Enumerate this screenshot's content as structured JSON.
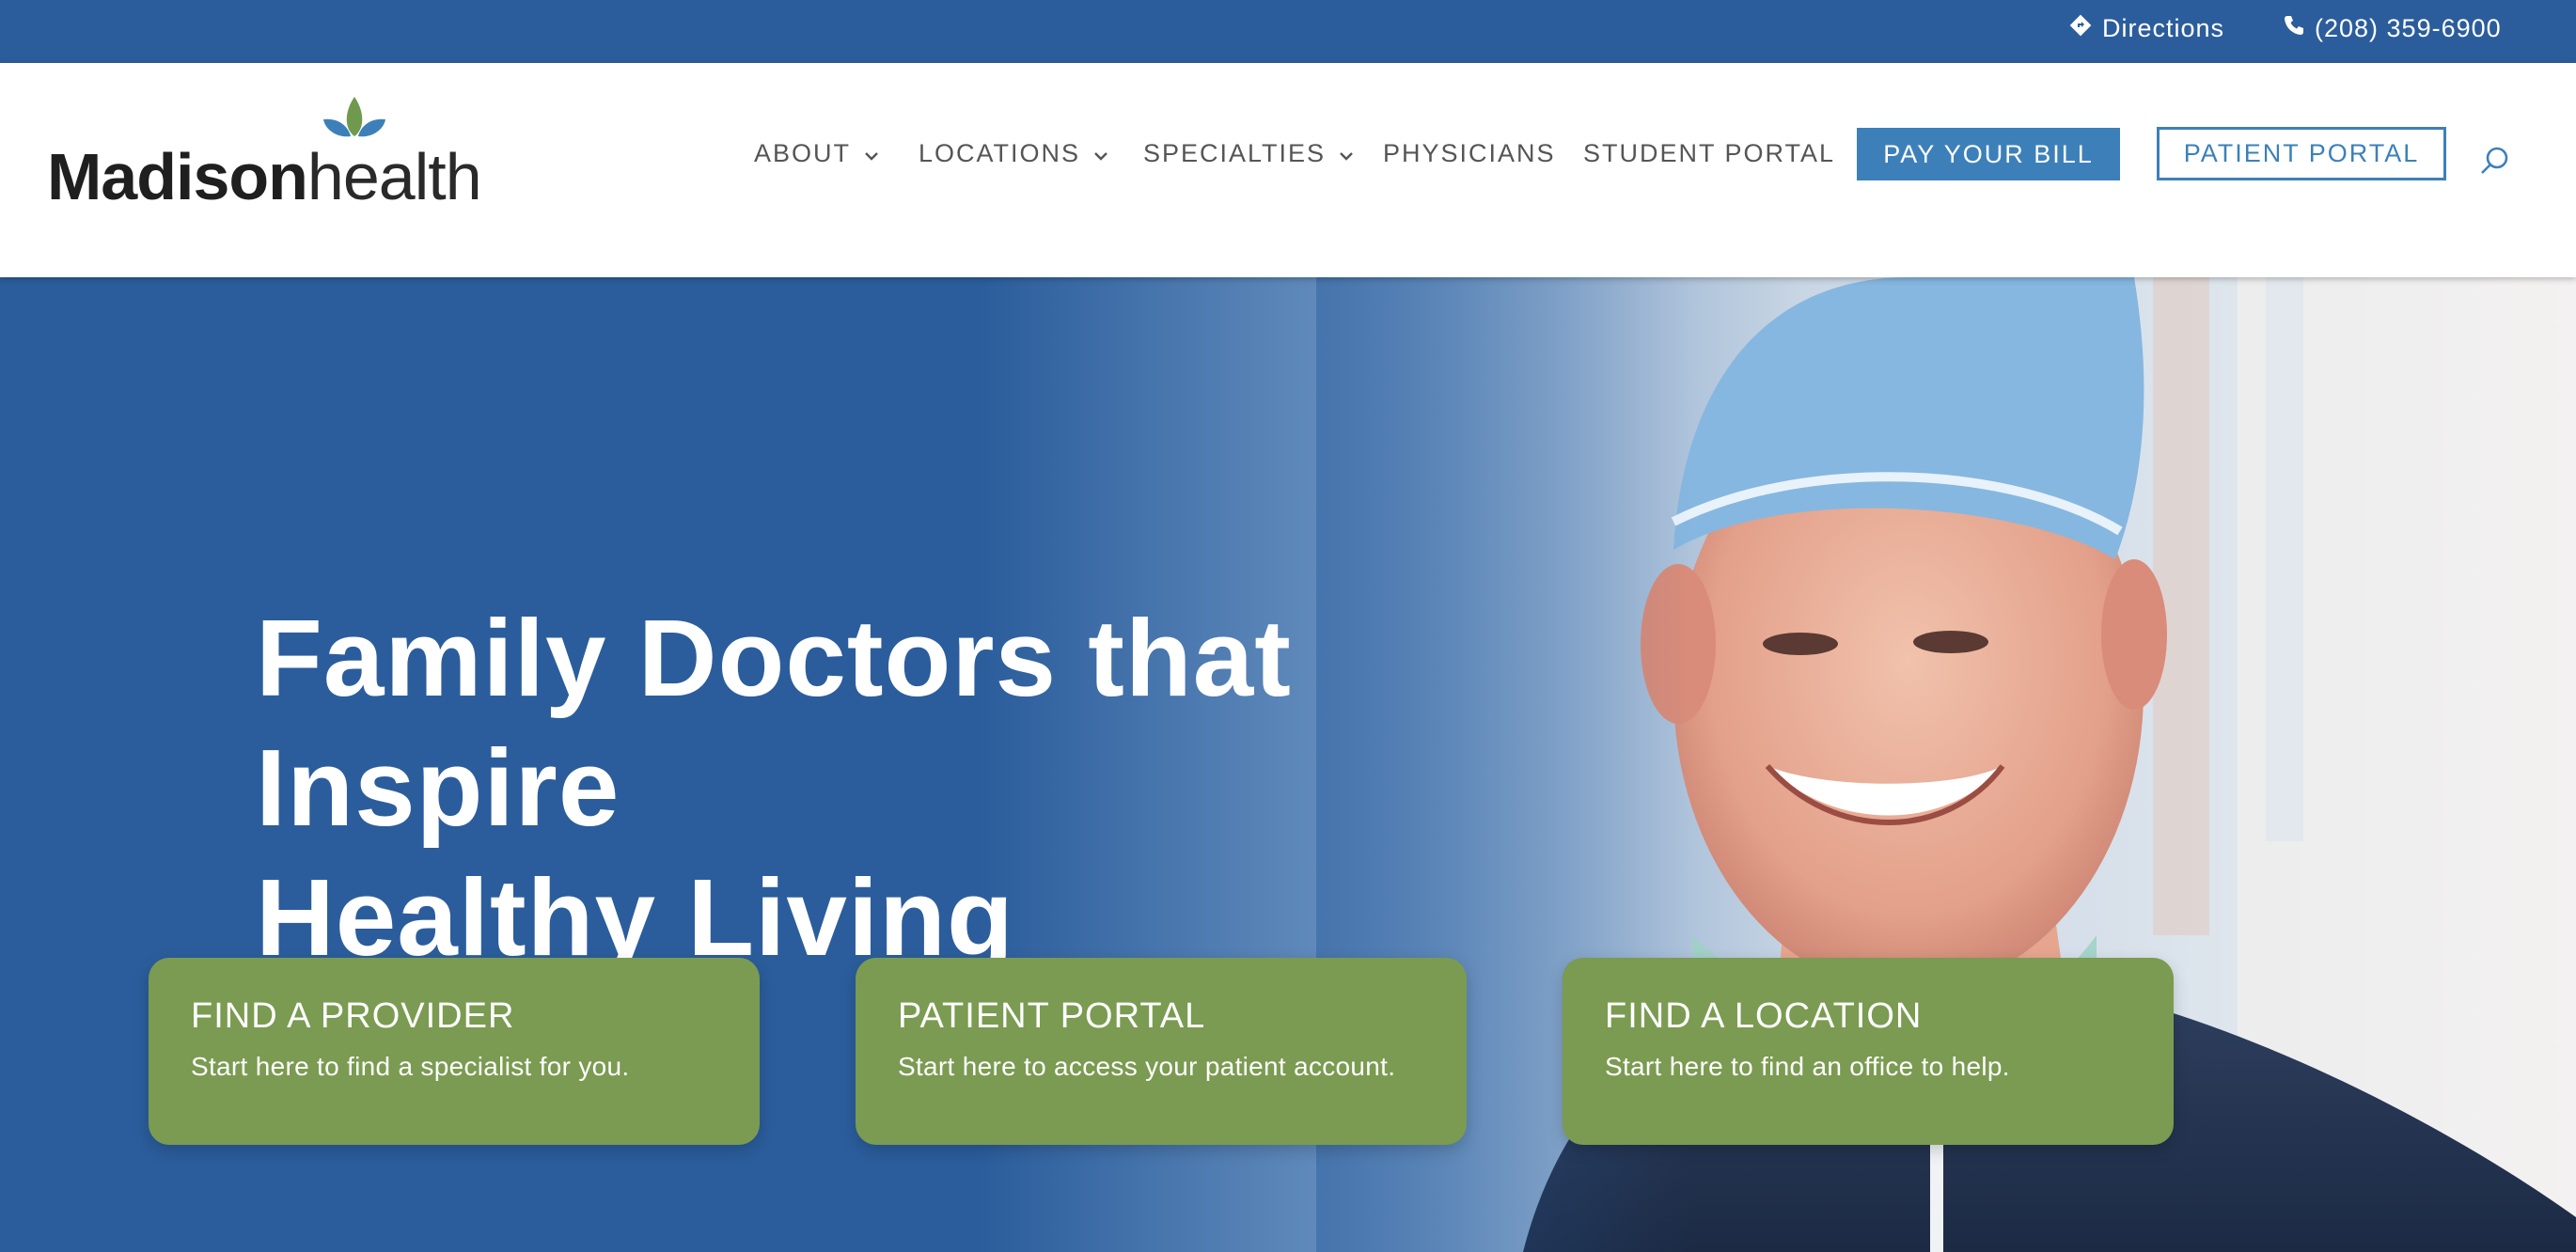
{
  "colors": {
    "brand_blue": "#2b5d9c",
    "button_blue": "#3d80b9",
    "card_green": "#7a9b51",
    "logo_leaf_green": "#6f9a4e",
    "logo_leaf_blue": "#3d80b9"
  },
  "topbar": {
    "directions_icon": "diamond-directions-icon",
    "directions_label": "Directions",
    "phone_icon": "phone-icon",
    "phone_label": "(208) 359-6900"
  },
  "header": {
    "logo": {
      "bold": "Madison",
      "light": "health"
    },
    "nav": [
      {
        "label": "ABOUT",
        "has_dropdown": true
      },
      {
        "label": "LOCATIONS",
        "has_dropdown": true
      },
      {
        "label": "SPECIALTIES",
        "has_dropdown": true
      },
      {
        "label": "PHYSICIANS",
        "has_dropdown": false
      },
      {
        "label": "STUDENT PORTAL",
        "has_dropdown": false
      }
    ],
    "pay_bill_label": "PAY YOUR BILL",
    "patient_portal_label": "PATIENT PORTAL",
    "search_icon": "search-icon"
  },
  "hero": {
    "title_line1": "Family Doctors that Inspire",
    "title_line2": "Healthy Living",
    "cards": [
      {
        "title": "FIND A PROVIDER",
        "subtitle": "Start here to find a specialist for you."
      },
      {
        "title": "PATIENT PORTAL",
        "subtitle": "Start here to access your patient account."
      },
      {
        "title": "FIND A LOCATION",
        "subtitle": "Start here to find an office to help."
      }
    ]
  }
}
